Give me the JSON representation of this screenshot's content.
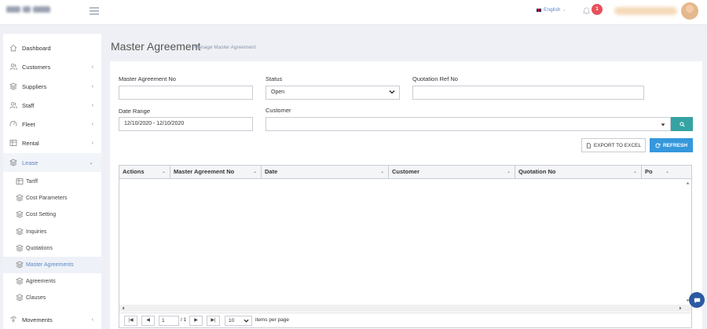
{
  "header": {
    "language": "English",
    "notification_count": "1"
  },
  "sidebar": {
    "items": [
      {
        "label": "Dashboard",
        "icon": "home-icon"
      },
      {
        "label": "Customers",
        "icon": "users-icon",
        "arrow": "‹"
      },
      {
        "label": "Suppliers",
        "icon": "layers-icon",
        "arrow": "‹"
      },
      {
        "label": "Staff",
        "icon": "users-icon",
        "arrow": "‹"
      },
      {
        "label": "Fleet",
        "icon": "gauge-icon",
        "arrow": "‹"
      },
      {
        "label": "Rental",
        "icon": "table-icon",
        "arrow": "‹"
      },
      {
        "label": "Lease",
        "icon": "layers-icon",
        "arrow": "⌄"
      }
    ],
    "lease_sub": [
      {
        "label": "Tariff",
        "icon": "table-icon"
      },
      {
        "label": "Cost Parameters",
        "icon": "layers-icon"
      },
      {
        "label": "Cost Setting",
        "icon": "layers-icon"
      },
      {
        "label": "Inquiries",
        "icon": "layers-icon"
      },
      {
        "label": "Quotations",
        "icon": "layers-icon"
      },
      {
        "label": "Master Agreements",
        "icon": "layers-icon"
      },
      {
        "label": "Agreements",
        "icon": "layers-icon"
      },
      {
        "label": "Clauses",
        "icon": "layers-icon"
      }
    ],
    "movements": {
      "label": "Movements",
      "icon": "steering-icon",
      "arrow": "‹"
    }
  },
  "page": {
    "title": "Master Agreement",
    "subtitle": "Manage Master Agreement"
  },
  "filters": {
    "master_agreement_no_label": "Master Agreement No",
    "master_agreement_no_value": "",
    "status_label": "Status",
    "status_value": "Open",
    "quotation_ref_label": "Quotation Ref No",
    "quotation_ref_value": "",
    "date_range_label": "Date Range",
    "date_range_value": "12/10/2020 - 12/10/2020",
    "customer_label": "Customer",
    "customer_value": ""
  },
  "actions": {
    "export_label": "EXPORT TO EXCEL",
    "refresh_label": "REFRESH"
  },
  "grid": {
    "columns": [
      "Actions",
      "Master Agreement No",
      "Date",
      "Customer",
      "Quotation No",
      "Po"
    ],
    "rows": []
  },
  "pager": {
    "current_page": "1",
    "total_pages": "/ 1",
    "page_size": "10",
    "items_per_page_label": "items per page"
  },
  "colors": {
    "accent": "#3598dc",
    "teal": "#36a3a3",
    "badge": "#e7505a",
    "active_text": "#5b86c4"
  }
}
